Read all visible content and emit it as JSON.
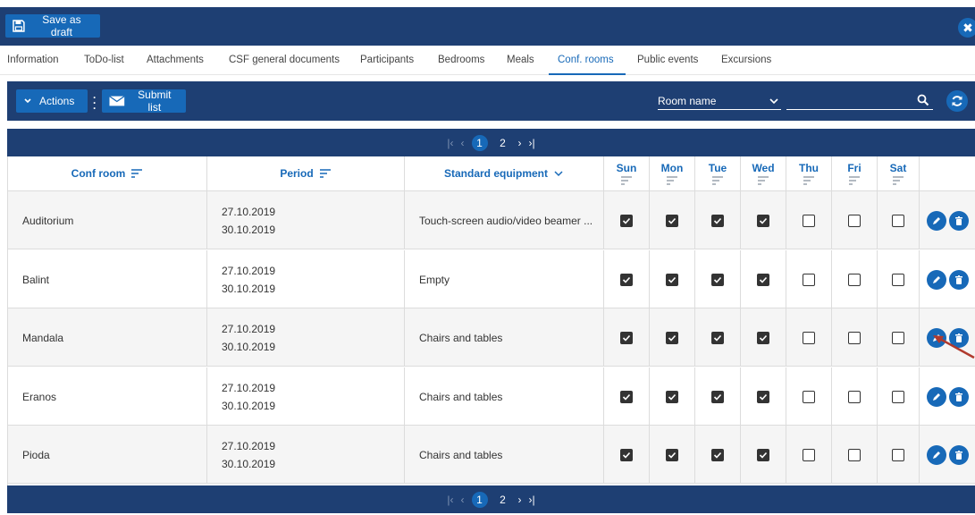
{
  "topbar": {
    "save_label": "Save as draft"
  },
  "tabs": [
    "Information",
    "ToDo-list",
    "Attachments",
    "CSF general documents",
    "Participants",
    "Bedrooms",
    "Meals",
    "Conf. rooms",
    "Public events",
    "Excursions"
  ],
  "active_tab": "Conf. rooms",
  "actionbar": {
    "actions_label": "Actions",
    "submit_label": "Submit list",
    "room_filter": "Room name"
  },
  "pager": {
    "pages": [
      "1",
      "2"
    ],
    "current": "1"
  },
  "table": {
    "headers": {
      "room": "Conf room",
      "period": "Period",
      "equipment": "Standard equipment"
    },
    "days": [
      "Sun",
      "Mon",
      "Tue",
      "Wed",
      "Thu",
      "Fri",
      "Sat"
    ],
    "rows": [
      {
        "room": "Auditorium",
        "start": "27.10.2019",
        "end": "30.10.2019",
        "equipment": "Touch-screen audio/video beamer ...",
        "days": [
          true,
          true,
          true,
          true,
          false,
          false,
          false
        ]
      },
      {
        "room": "Balint",
        "start": "27.10.2019",
        "end": "30.10.2019",
        "equipment": "Empty",
        "days": [
          true,
          true,
          true,
          true,
          false,
          false,
          false
        ]
      },
      {
        "room": "Mandala",
        "start": "27.10.2019",
        "end": "30.10.2019",
        "equipment": "Chairs and tables",
        "days": [
          true,
          true,
          true,
          true,
          false,
          false,
          false
        ]
      },
      {
        "room": "Eranos",
        "start": "27.10.2019",
        "end": "30.10.2019",
        "equipment": "Chairs and tables",
        "days": [
          true,
          true,
          true,
          true,
          false,
          false,
          false
        ]
      },
      {
        "room": "Pioda",
        "start": "27.10.2019",
        "end": "30.10.2019",
        "equipment": "Chairs and tables",
        "days": [
          true,
          true,
          true,
          true,
          false,
          false,
          false
        ]
      }
    ]
  },
  "colors": {
    "bar": "#1e3f73",
    "accent": "#1769b8",
    "annotation_arrow": "#b03a2e"
  }
}
